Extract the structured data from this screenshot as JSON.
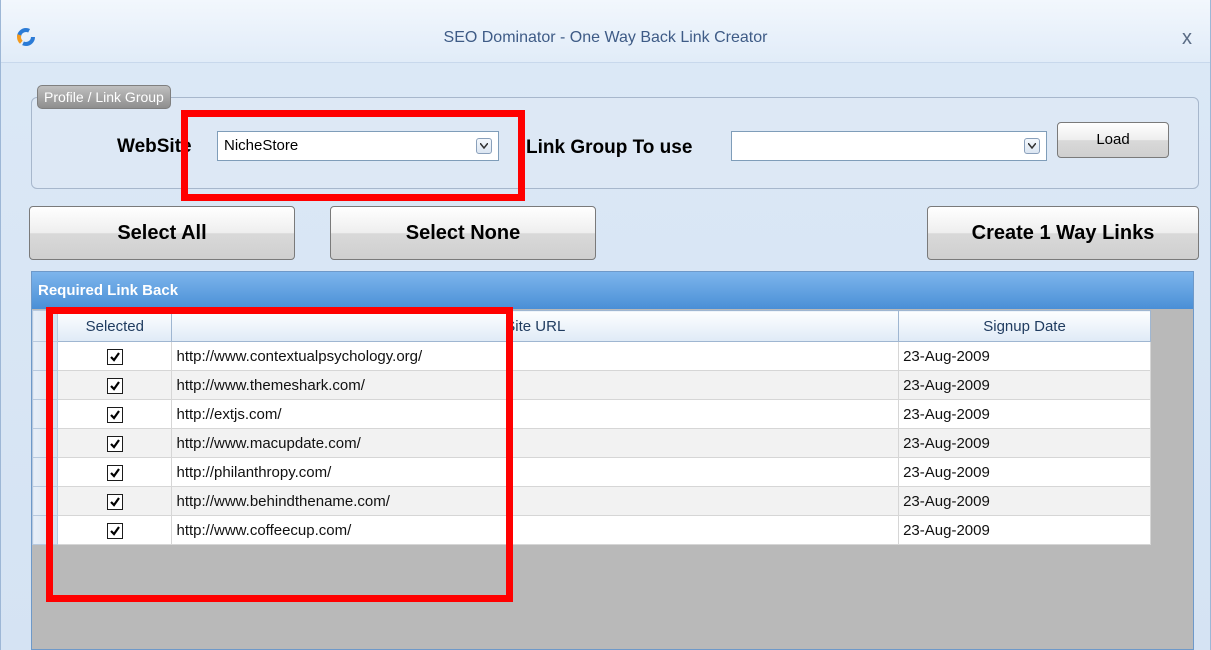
{
  "window": {
    "title": "SEO Dominator - One Way Back Link Creator",
    "close_glyph": "x"
  },
  "profile_group": {
    "title": "Profile / Link Group",
    "website_label": "WebSite",
    "website_value": "NicheStore",
    "link_group_label": "Link Group To use",
    "link_group_value": "",
    "load_label": "Load"
  },
  "actions": {
    "select_all": "Select All",
    "select_none": "Select None",
    "create_links": "Create 1 Way Links"
  },
  "grid": {
    "caption": "Required Link Back",
    "columns": {
      "selected": "Selected",
      "site_url": "Site URL",
      "signup_date": "Signup Date"
    },
    "rows": [
      {
        "selected": true,
        "url": "http://www.contextualpsychology.org/",
        "date": "23-Aug-2009"
      },
      {
        "selected": true,
        "url": "http://www.themeshark.com/",
        "date": "23-Aug-2009"
      },
      {
        "selected": true,
        "url": "http://extjs.com/",
        "date": "23-Aug-2009"
      },
      {
        "selected": true,
        "url": "http://www.macupdate.com/",
        "date": "23-Aug-2009"
      },
      {
        "selected": true,
        "url": "http://philanthropy.com/",
        "date": "23-Aug-2009"
      },
      {
        "selected": true,
        "url": "http://www.behindthename.com/",
        "date": "23-Aug-2009"
      },
      {
        "selected": true,
        "url": "http://www.coffeecup.com/",
        "date": "23-Aug-2009"
      }
    ]
  },
  "colors": {
    "highlight": "#ff0000",
    "grid_caption": "#4a8fd6",
    "title_text": "#3e5b86"
  }
}
